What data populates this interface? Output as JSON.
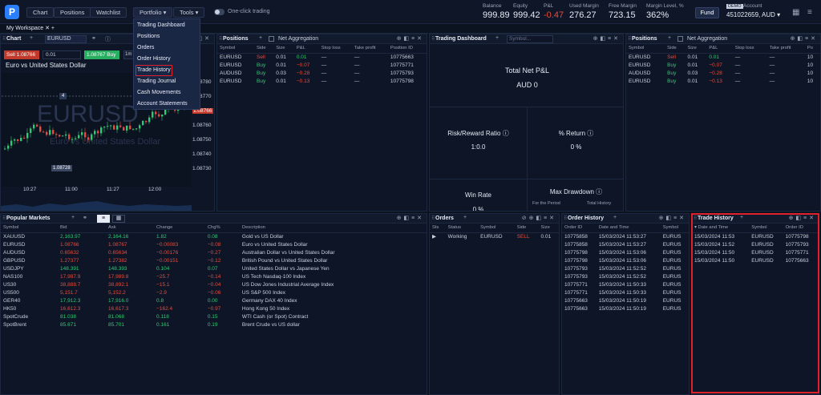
{
  "topbar": {
    "logo": "P",
    "nav": [
      "Chart",
      "Positions",
      "Watchlist"
    ],
    "menus": [
      "Portfolio ▾",
      "Tools ▾"
    ],
    "one_click": "One-click trading",
    "metrics": [
      {
        "label": "Balance",
        "value": "999.89"
      },
      {
        "label": "Equity",
        "value": "999.42"
      },
      {
        "label": "P&L",
        "value": "-0.47"
      },
      {
        "label": "Used Margin",
        "value": "276.27"
      },
      {
        "label": "Free Margin",
        "value": "723.15"
      },
      {
        "label": "Margin Level, %",
        "value": "362%"
      }
    ],
    "fund": "Fund",
    "demo": "DEMO",
    "account_label": "Account",
    "account_value": "451022659, AUD ▾"
  },
  "workspace": {
    "tab": "My Workspace ✕ +"
  },
  "portfolio_menu": [
    "Trading Dashboard",
    "Positions",
    "Orders",
    "Order History",
    "Trade History",
    "Trading Journal",
    "Cash Movements",
    "Account Statements"
  ],
  "chart": {
    "title": "Chart",
    "symbol": "EURUSD",
    "sell": "Sell 1.08766",
    "qty": "0.01",
    "buy": "1.08767 Buy",
    "interval": "1m",
    "desc": "Euro vs United States Dollar",
    "watermark": "EURUSD",
    "watermark_sub": "Euro vs United States Dollar",
    "order_tag": "4",
    "price_tag": "1.08728",
    "prices": [
      "1.08780",
      "1.08770",
      "1.08766",
      "1.08760",
      "1.08750",
      "1.08740",
      "1.08730"
    ],
    "times": [
      "10:27",
      "11:00",
      "11:27",
      "12:00"
    ]
  },
  "positions": {
    "title": "Positions",
    "net": "Net Aggregation",
    "headers": [
      "Symbol",
      "Side",
      "Size",
      "P&L",
      "Stop loss",
      "Take profit",
      "Position ID"
    ],
    "rows": [
      [
        "EURUSD",
        "Sell",
        "0.01",
        "0.01",
        "—",
        "—",
        "10775663"
      ],
      [
        "EURUSD",
        "Buy",
        "0.01",
        "−0.07",
        "—",
        "—",
        "10775771"
      ],
      [
        "AUDUSD",
        "Buy",
        "0.03",
        "−0.28",
        "—",
        "—",
        "10775793"
      ],
      [
        "EURUSD",
        "Buy",
        "0.01",
        "−0.13",
        "—",
        "—",
        "10775798"
      ]
    ]
  },
  "dashboard": {
    "title": "Trading Dashboard",
    "search": "Symbol...",
    "net_pl": "Total Net P&L",
    "net_pl_val": "AUD 0",
    "rr": "Risk/Reward Ratio ⓘ",
    "rr_val": "1:0.0",
    "ret": "% Return ⓘ",
    "ret_val": "0 %",
    "win": "Win Rate",
    "win_val": "0 %",
    "dd": "Max Drawdown ⓘ",
    "period": "For the Period",
    "total": "Total History"
  },
  "positions2": {
    "title": "Positions",
    "net": "Net Aggregation",
    "headers": [
      "Symbol",
      "Side",
      "Size",
      "P&L",
      "Stop loss",
      "Take profit",
      "Po"
    ],
    "rows": [
      [
        "EURUSD",
        "Sell",
        "0.01",
        "0.01",
        "—",
        "—",
        "10"
      ],
      [
        "EURUSD",
        "Buy",
        "0.01",
        "−0.07",
        "—",
        "—",
        "10"
      ],
      [
        "AUDUSD",
        "Buy",
        "0.03",
        "−0.28",
        "—",
        "—",
        "10"
      ],
      [
        "EURUSD",
        "Buy",
        "0.01",
        "−0.13",
        "—",
        "—",
        "10"
      ]
    ]
  },
  "markets": {
    "title": "Popular Markets",
    "headers": [
      "Symbol",
      "Bid",
      "Ask",
      "Change",
      "Chg%",
      "Description"
    ],
    "rows": [
      [
        "XAUUSD",
        "2,163.97",
        "2,164.16",
        "1.82",
        "0.08",
        "Gold vs US Dollar"
      ],
      [
        "EURUSD",
        "1.08766",
        "1.08767",
        "−0.00083",
        "−0.08",
        "Euro vs United States Dollar"
      ],
      [
        "AUDUSD",
        "0.65632",
        "0.65634",
        "−0.00176",
        "−0.27",
        "Australian Dollar vs United States Dollar"
      ],
      [
        "GBPUSD",
        "1.27377",
        "1.27382",
        "−0.00151",
        "−0.12",
        "British Pound vs United States Dollar"
      ],
      [
        "USDJPY",
        "148.391",
        "148.393",
        "0.104",
        "0.07",
        "United States Dollar vs Japanese Yen"
      ],
      [
        "NAS100",
        "17,987.9",
        "17,989.8",
        "−25.7",
        "−0.14",
        "US Tech Nasdaq-100 Index"
      ],
      [
        "US30",
        "38,888.7",
        "38,892.1",
        "−15.1",
        "−0.04",
        "US Dow Jones Industrial Average Index"
      ],
      [
        "US500",
        "5,151.7",
        "5,152.2",
        "−2.9",
        "−0.06",
        "US S&P 500 Index"
      ],
      [
        "GER40",
        "17,912.3",
        "17,916.0",
        "0.8",
        "0.00",
        "Germany DAX 40 Index"
      ],
      [
        "HK50",
        "16,612.3",
        "16,617.3",
        "−162.4",
        "−0.97",
        "Hong Kong 50 Index"
      ],
      [
        "SpotCrude",
        "81.038",
        "81.068",
        "0.118",
        "0.15",
        "WTI Cash (or Spot) Contract"
      ],
      [
        "SpotBrent",
        "85.671",
        "85.701",
        "0.161",
        "0.19",
        "Brent Crude vs US dollar"
      ]
    ]
  },
  "orders": {
    "title": "Orders",
    "headers": [
      "Sts",
      "Status",
      "Symbol",
      "Side",
      "Size"
    ],
    "rows": [
      [
        "▶",
        "Working",
        "EURUSD",
        "SELL",
        "0.01"
      ]
    ]
  },
  "order_history": {
    "title": "Order History",
    "headers": [
      "Order ID",
      "Date and Time",
      "Symbol"
    ],
    "rows": [
      [
        "10775858",
        "15/03/2024 11:53:27",
        "EURUS"
      ],
      [
        "10775858",
        "15/03/2024 11:53:27",
        "EURUS"
      ],
      [
        "10775798",
        "15/03/2024 11:53:06",
        "EURUS"
      ],
      [
        "10775798",
        "15/03/2024 11:53:06",
        "EURUS"
      ],
      [
        "10775793",
        "15/03/2024 11:52:52",
        "EURUS"
      ],
      [
        "10775793",
        "15/03/2024 11:52:52",
        "EURUS"
      ],
      [
        "10775771",
        "15/03/2024 11:50:33",
        "EURUS"
      ],
      [
        "10775771",
        "15/03/2024 11:50:33",
        "EURUS"
      ],
      [
        "10775663",
        "15/03/2024 11:50:19",
        "EURUS"
      ],
      [
        "10775663",
        "15/03/2024 11:50:19",
        "EURUS"
      ]
    ]
  },
  "trade_history": {
    "title": "Trade History",
    "headers": [
      "▾ Date and Time",
      "Symbol",
      "Order ID"
    ],
    "rows": [
      [
        "15/03/2024 11:53",
        "EURUSD",
        "10775798"
      ],
      [
        "15/03/2024 11:52",
        "EURUSD",
        "10775793"
      ],
      [
        "15/03/2024 11:50",
        "EURUSD",
        "10775771"
      ],
      [
        "15/03/2024 11:50",
        "EURUSD",
        "10775663"
      ]
    ]
  },
  "colors": {
    "accent": "#2a7fff",
    "buy": "#2ecc71",
    "sell": "#e74c3c",
    "highlight": "#e0202a"
  }
}
